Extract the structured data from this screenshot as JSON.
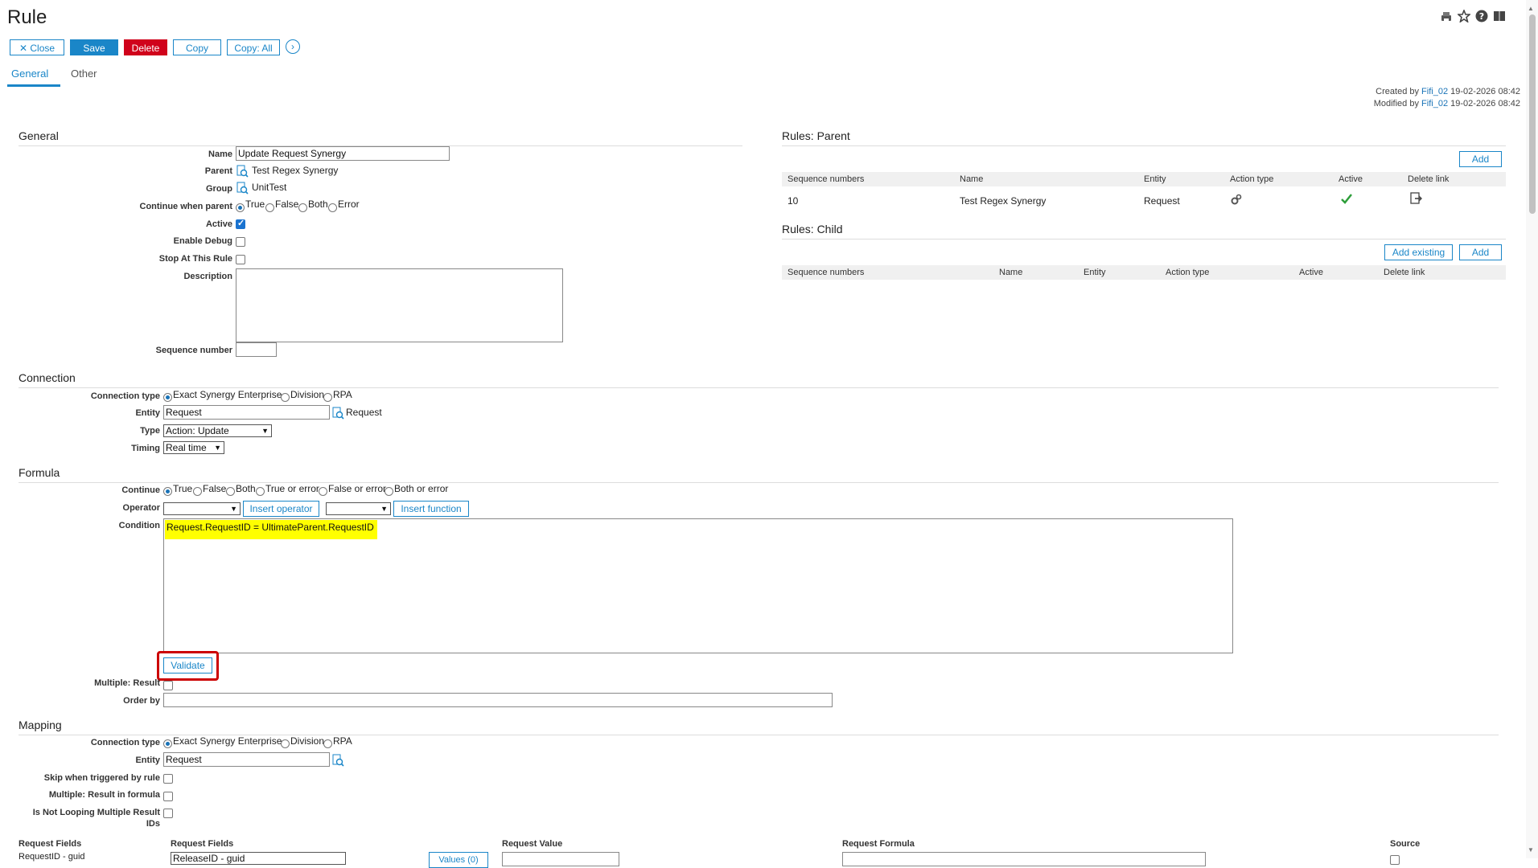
{
  "header": {
    "title": "Rule",
    "toolbar": {
      "close": "Close",
      "save": "Save",
      "delete": "Delete",
      "copy": "Copy",
      "copy_all": "Copy: All"
    },
    "icons": [
      "print-icon",
      "star-icon",
      "help-icon",
      "book-icon"
    ]
  },
  "tabs": [
    {
      "label": "General",
      "active": true
    },
    {
      "label": "Other",
      "active": false
    }
  ],
  "meta": {
    "created_prefix": "Created by",
    "created_user": "Fifi_02",
    "created_date": "19-02-2026 08:42",
    "modified_prefix": "Modified by",
    "modified_user": "Fifi_02",
    "modified_date": "19-02-2026 08:42"
  },
  "general": {
    "section_title": "General",
    "name_label": "Name",
    "name_value": "Update Request Synergy",
    "parent_label": "Parent",
    "parent_value": "Test Regex Synergy",
    "group_label": "Group",
    "group_value": "UnitTest",
    "continue_label": "Continue when parent",
    "continue_options": [
      "True",
      "False",
      "Both",
      "Error"
    ],
    "continue_selected": "True",
    "active_label": "Active",
    "active_checked": true,
    "debug_label": "Enable Debug",
    "stop_label": "Stop At This Rule",
    "description_label": "Description",
    "sequence_label": "Sequence number"
  },
  "rules_parent": {
    "title": "Rules: Parent",
    "add": "Add",
    "columns": [
      "Sequence numbers",
      "Name",
      "Entity",
      "Action type",
      "Active",
      "Delete link"
    ],
    "rows": [
      {
        "seq": "10",
        "name": "Test Regex Synergy",
        "entity": "Request"
      }
    ]
  },
  "rules_child": {
    "title": "Rules: Child",
    "add_existing": "Add existing",
    "add": "Add",
    "columns": [
      "Sequence numbers",
      "Name",
      "Entity",
      "Action type",
      "Active",
      "Delete link"
    ]
  },
  "connection": {
    "section_title": "Connection",
    "type_label": "Connection type",
    "type_options": [
      "Exact Synergy Enterprise",
      "Division",
      "RPA"
    ],
    "type_selected": "Exact Synergy Enterprise",
    "entity_label": "Entity",
    "entity_value": "Request",
    "entity_display": "Request",
    "typ_label": "Type",
    "typ_value": "Action: Update",
    "timing_label": "Timing",
    "timing_value": "Real time"
  },
  "formula": {
    "section_title": "Formula",
    "continue_label": "Continue",
    "continue_options": [
      "True",
      "False",
      "Both",
      "True or error",
      "False or error",
      "Both or error"
    ],
    "continue_selected": "True",
    "operator_label": "Operator",
    "insert_operator": "Insert operator",
    "insert_function": "Insert function",
    "condition_label": "Condition",
    "condition_value": "Request.RequestID = UltimateParent.RequestID",
    "highlight_color": "#ffff00",
    "validate": "Validate",
    "validate_outline_color": "#cc0000",
    "multiple_label": "Multiple: Result",
    "order_label": "Order by"
  },
  "mapping": {
    "section_title": "Mapping",
    "type_label": "Connection type",
    "type_options": [
      "Exact Synergy Enterprise",
      "Division",
      "RPA"
    ],
    "type_selected": "Exact Synergy Enterprise",
    "entity_label": "Entity",
    "entity_value": "Request",
    "skip_label": "Skip when triggered by rule",
    "multiple_formula_label": "Multiple: Result in formula",
    "not_looping_label_1": "Is Not Looping Multiple Result",
    "not_looping_label_2": "IDs",
    "columns": [
      "Request Fields",
      "Request Fields",
      "Request Value",
      "Request Formula",
      "Source"
    ],
    "row_partial_field": "RequestID - guid",
    "row_partial_select": "ReleaseID - guid",
    "row_partial_values": "Values (0)"
  }
}
